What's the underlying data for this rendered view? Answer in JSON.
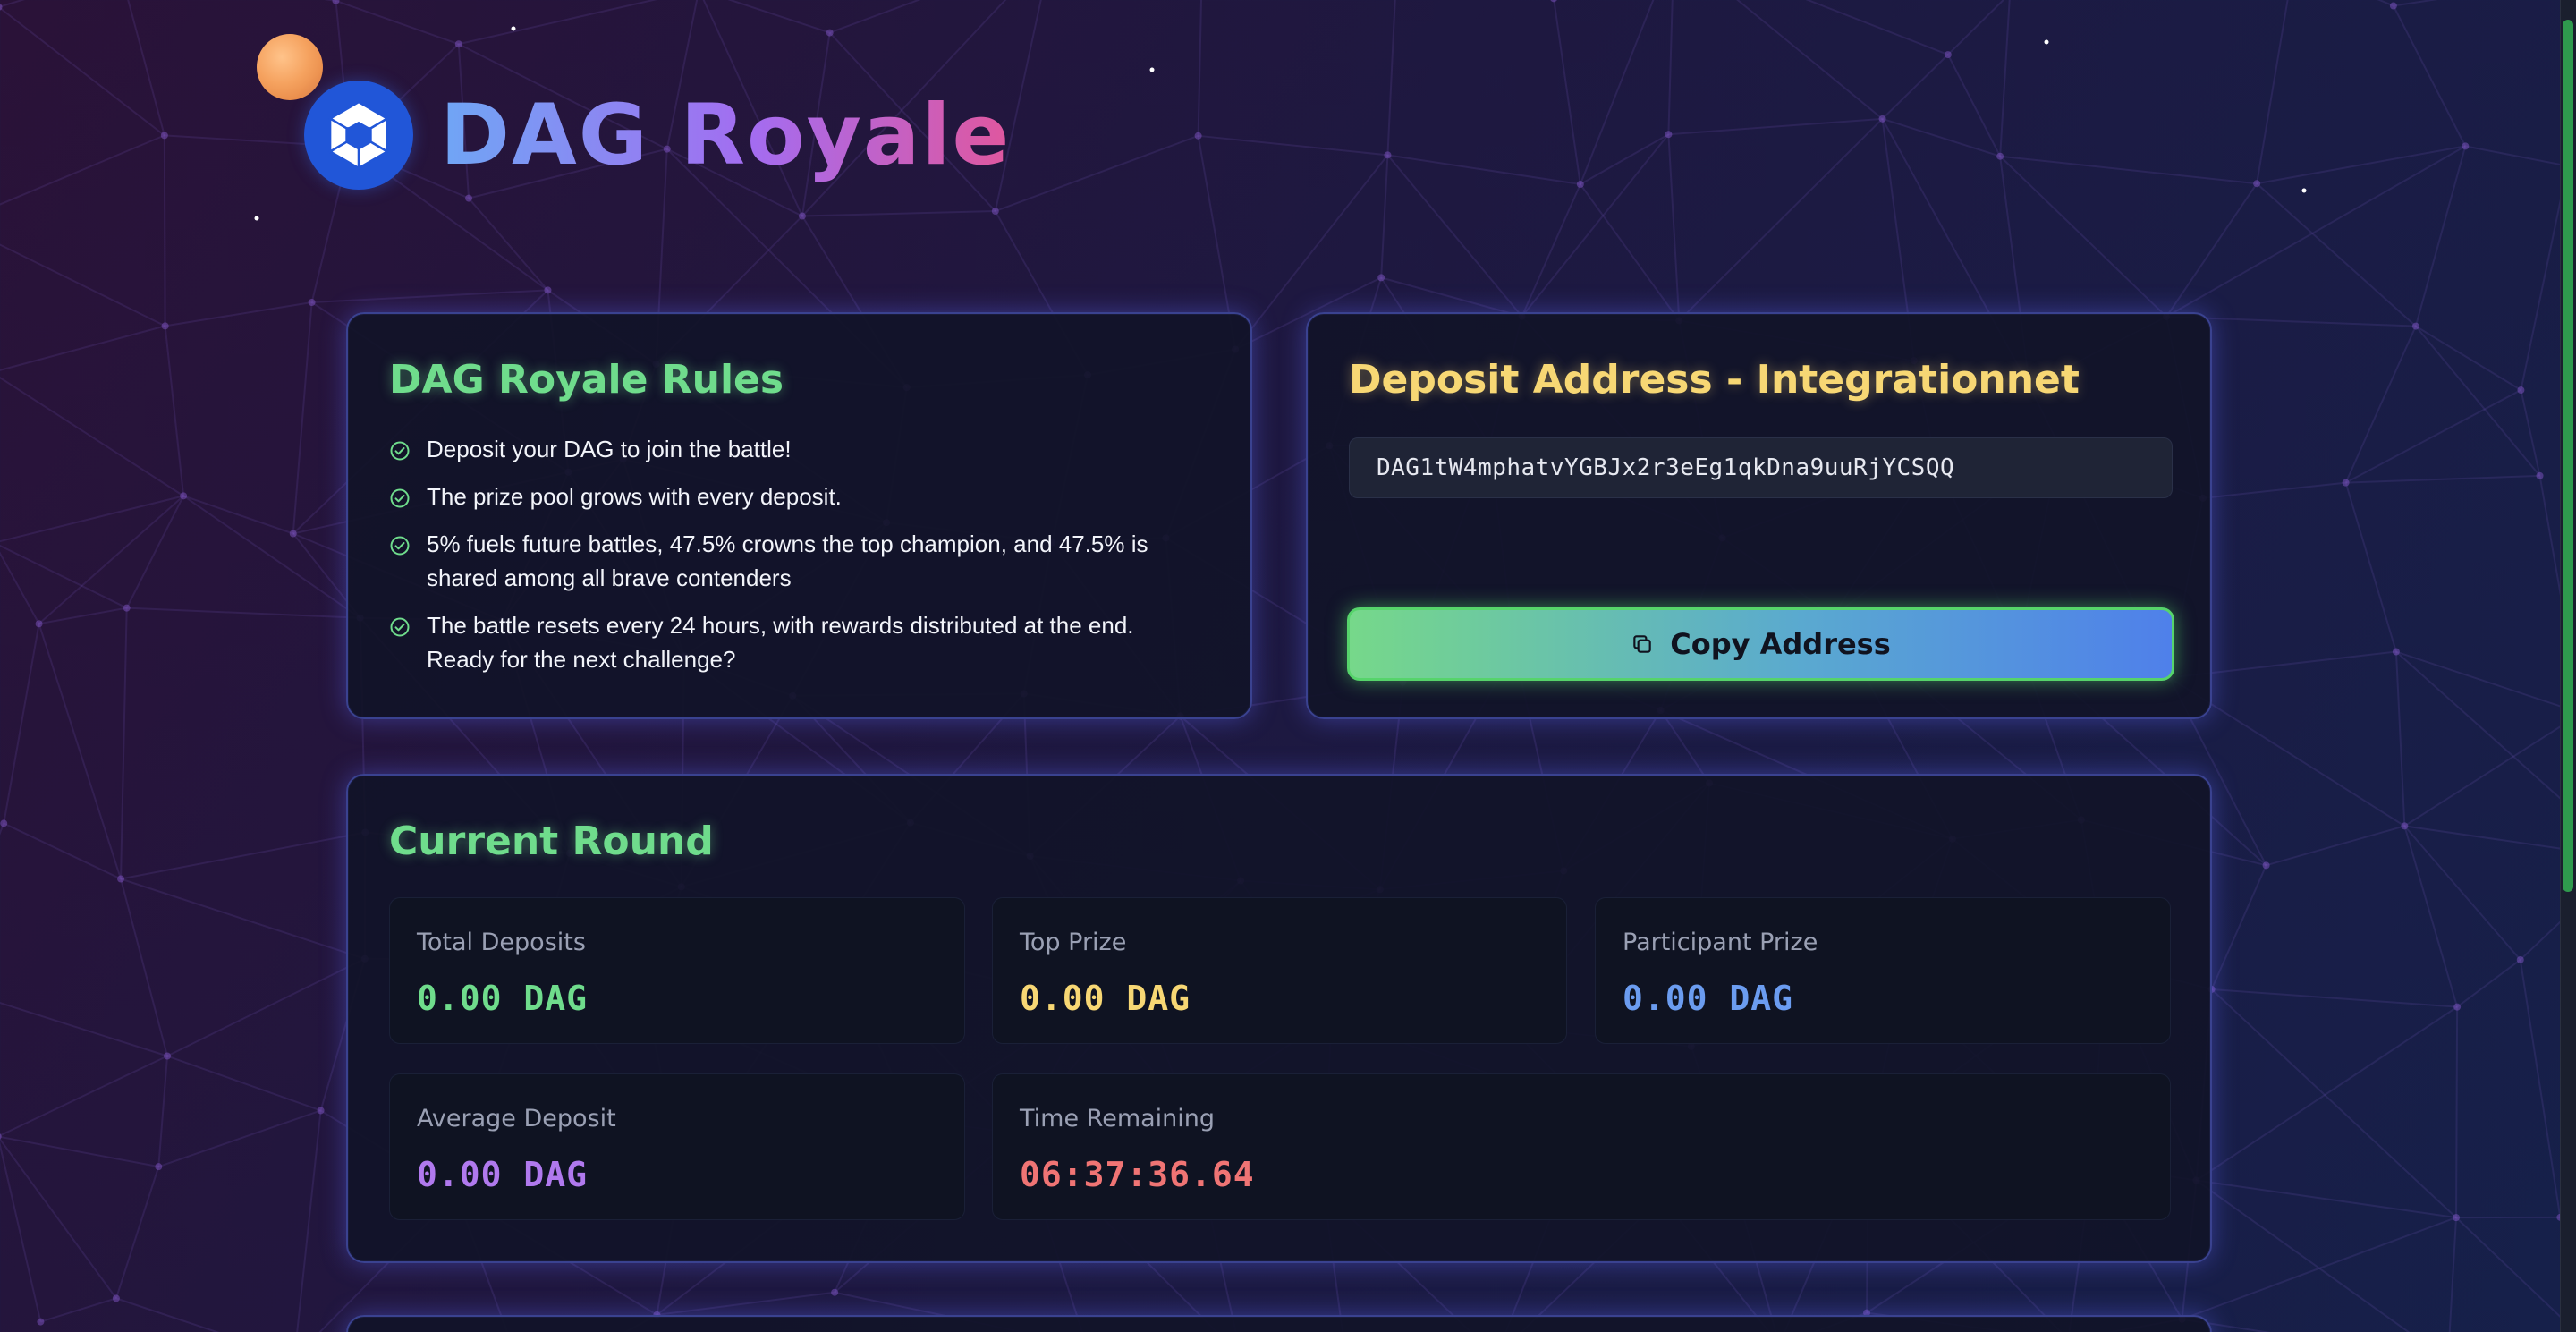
{
  "brand": {
    "name": "DAG Royale"
  },
  "rules": {
    "title": "DAG Royale Rules",
    "items": [
      "Deposit your DAG to join the battle!",
      "The prize pool grows with every deposit.",
      "5% fuels future battles, 47.5% crowns the top champion, and 47.5% is shared among all brave contenders",
      "The battle resets every 24 hours, with rewards distributed at the end. Ready for the next challenge?"
    ]
  },
  "deposit": {
    "title": "Deposit Address - Integrationnet",
    "address": "DAG1tW4mphatvYGBJx2r3eEg1qkDna9uuRjYCSQQ",
    "copy_label": "Copy Address"
  },
  "round": {
    "title": "Current Round",
    "total_deposits": {
      "label": "Total Deposits",
      "value": "0.00 DAG"
    },
    "top_prize": {
      "label": "Top Prize",
      "value": "0.00 DAG"
    },
    "participant_prize": {
      "label": "Participant Prize",
      "value": "0.00 DAG"
    },
    "average_deposit": {
      "label": "Average Deposit",
      "value": "0.00 DAG"
    },
    "time_remaining": {
      "label": "Time Remaining",
      "value": "06:37:36.64"
    }
  },
  "colors": {
    "green": "#6fdc8c",
    "yellow": "#f7d774",
    "blue": "#6b9cf0",
    "purple": "#b079ee",
    "red": "#ef7474"
  },
  "icons": {
    "logo": "shutter-logo-icon",
    "rule_bullet": "check-circle-icon",
    "copy": "copy-icon"
  }
}
